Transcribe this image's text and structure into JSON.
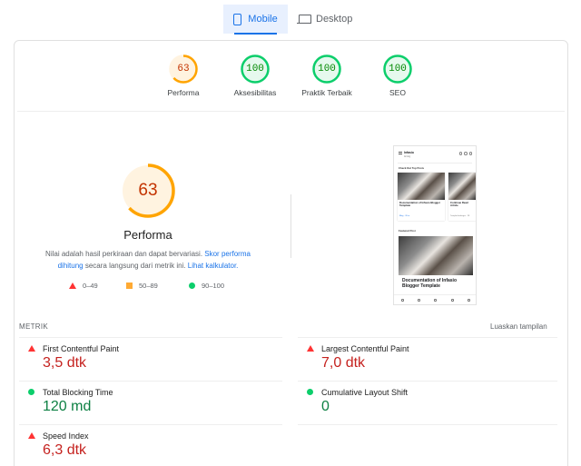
{
  "tabs": [
    {
      "label": "Mobile",
      "icon": "phone-icon",
      "active": true
    },
    {
      "label": "Desktop",
      "icon": "laptop-icon",
      "active": false
    }
  ],
  "summary_gauges": [
    {
      "score": "63",
      "label": "Performa",
      "color": "#ffa400"
    },
    {
      "score": "100",
      "label": "Aksesibilitas",
      "color": "#0cce6b"
    },
    {
      "score": "100",
      "label": "Praktik Terbaik",
      "color": "#0cce6b"
    },
    {
      "score": "100",
      "label": "SEO",
      "color": "#0cce6b"
    }
  ],
  "performance": {
    "score": "63",
    "score_fraction": 0.63,
    "title": "Performa",
    "desc_text": "Nilai adalah hasil perkiraan dan dapat bervariasi. ",
    "desc_link1": "Skor performa dihitung",
    "desc_mid": " secara langsung dari metrik ini. ",
    "desc_link2": "Lihat kalkulator.",
    "legend": [
      {
        "range": "0–49",
        "icon": "red-triangle-icon",
        "color": "#ff3333"
      },
      {
        "range": "50–89",
        "icon": "orange-square-icon",
        "color": "#ffaa33"
      },
      {
        "range": "90–100",
        "icon": "green-circle-icon",
        "color": "#0cce6b"
      }
    ]
  },
  "screenshot": {
    "brand": "Infasio",
    "brand_sub": "Ai blog",
    "section1": "Check Out Top Posts",
    "card1_title": "Documentation of Infasio Blogger Template",
    "card1_meta": "Blog · 26 m",
    "card2_title": "Continue Read Article",
    "card2_meta": "Templat berbagai · 28",
    "section2": "Featured Post",
    "featured_title": "Documentation of Infasio Blogger Template"
  },
  "metrics_header": {
    "label": "METRIK",
    "expand": "Luaskan tampilan"
  },
  "metrics": [
    {
      "name": "First Contentful Paint",
      "value": "3,5 dtk",
      "status": "red",
      "icon": "red-triangle-icon"
    },
    {
      "name": "Largest Contentful Paint",
      "value": "7,0 dtk",
      "status": "red",
      "icon": "red-triangle-icon"
    },
    {
      "name": "Total Blocking Time",
      "value": "120 md",
      "status": "green",
      "icon": "green-circle-icon"
    },
    {
      "name": "Cumulative Layout Shift",
      "value": "0",
      "status": "green",
      "icon": "green-circle-icon"
    },
    {
      "name": "Speed Index",
      "value": "6,3 dtk",
      "status": "red",
      "icon": "red-triangle-icon"
    }
  ]
}
